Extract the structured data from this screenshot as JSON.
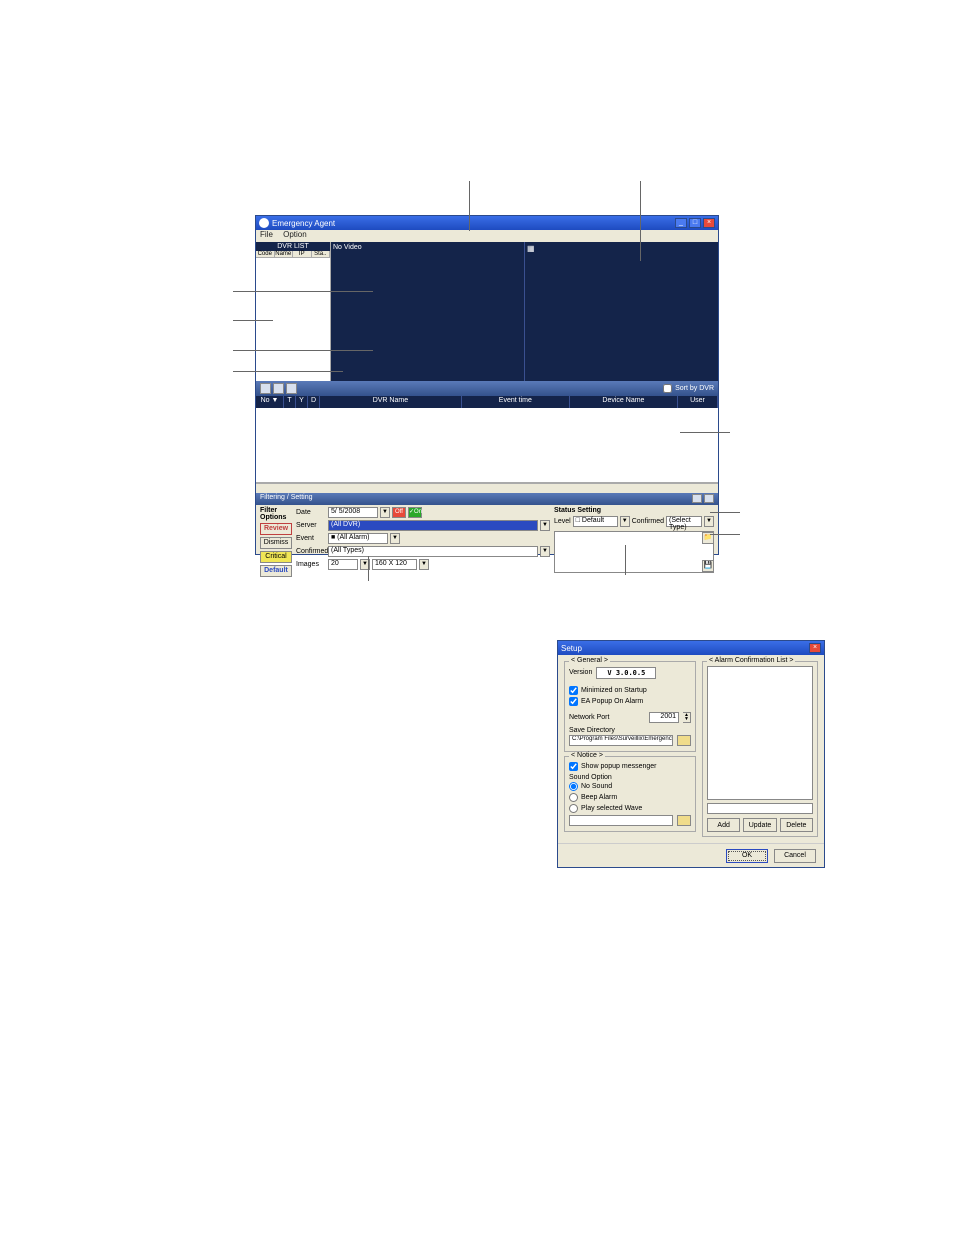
{
  "main": {
    "title": "Emergency Agent",
    "menu": {
      "file": "File",
      "option": "Option"
    },
    "dvr_panel": {
      "header": "DVR LIST",
      "cols": [
        "Code",
        "Name",
        "IP",
        "Sta.."
      ]
    },
    "video": {
      "no_video": "No Video"
    },
    "event_toolbar": {
      "sort_label": "Sort by DVR"
    },
    "event_cols": {
      "no": "No ▼",
      "t": "T",
      "y": "Y",
      "d": "D",
      "dvr_name": "DVR Name",
      "event_time": "Event time",
      "device_name": "Device Name",
      "user": "User"
    },
    "filter": {
      "title": "Filtering / Setting",
      "filter_options": "Filter Options",
      "buttons": {
        "review": "Review",
        "dismiss": "Dismiss",
        "critical": "Critical",
        "default": "Default"
      },
      "rows": {
        "date_lbl": "Date",
        "date_val": "5/ 5/2008",
        "off": "Off",
        "on": "On",
        "server_lbl": "Server",
        "server_val": "(All DVR)",
        "event_lbl": "Event",
        "event_val": "■ (All Alarm)",
        "confirmed_lbl": "Confirmed",
        "confirmed_val": "(All Types)",
        "images_lbl": "Images",
        "images_val": "20",
        "images_size": "160 X 120"
      },
      "status": {
        "title": "Status Setting",
        "level_lbl": "Level",
        "level_val": "□ Default",
        "confirmed_lbl": "Confirmed",
        "confirmed_val": "(Select Type)"
      }
    }
  },
  "setup": {
    "title": "Setup",
    "general": {
      "legend": "< General >",
      "version_lbl": "Version",
      "version_val": "V 3.0.0.5",
      "minimized": "Minimized on Startup",
      "ea_popup": "EA Popup On Alarm",
      "port_lbl": "Network Port",
      "port_val": "2001",
      "save_dir_lbl": "Save Directory",
      "save_dir_val": "C:\\Program Files\\Surveillix\\Emergency Agent\\EA"
    },
    "notice": {
      "legend": "< Notice >",
      "show_popup": "Show popup messenger",
      "sound_lbl": "Sound Option",
      "no_sound": "No Sound",
      "beep": "Beep Alarm",
      "play_wave": "Play selected Wave"
    },
    "alarm": {
      "legend": "< Alarm Confirmation List >",
      "add": "Add",
      "update": "Update",
      "delete": "Delete"
    },
    "footer": {
      "ok": "OK",
      "cancel": "Cancel"
    }
  }
}
